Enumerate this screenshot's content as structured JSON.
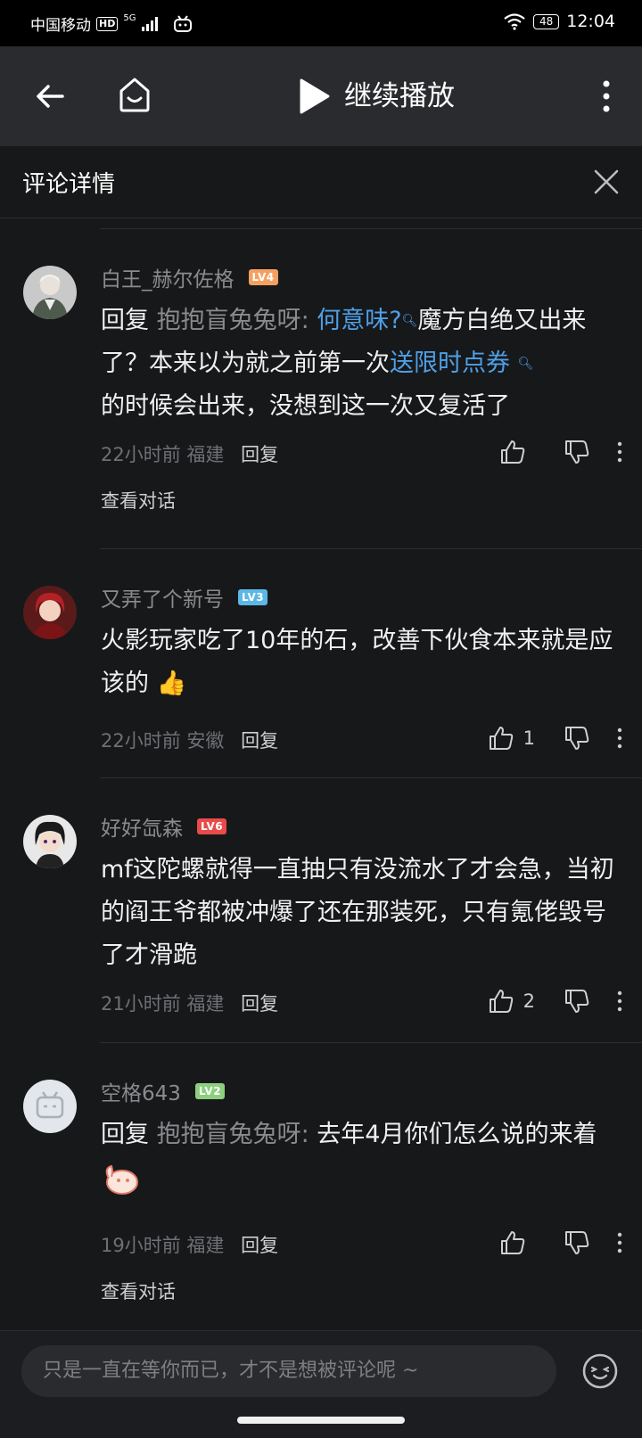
{
  "status_bar": {
    "carrier": "中国移动",
    "hd": "HD",
    "network": "5G",
    "battery": "48",
    "time": "12:04"
  },
  "nav": {
    "title": "继续播放"
  },
  "header": {
    "title": "评论详情"
  },
  "colors": {
    "background": "#17181a",
    "link": "#4fa0e6",
    "lv4": "#f5a062",
    "lv3": "#5bb8e6",
    "lv6": "#e84b4b",
    "lv2": "#8ccf7e"
  },
  "comments": [
    {
      "username": "白王_赫尔佐格",
      "level": "LV4",
      "content": {
        "reply_prefix": "回复 ",
        "reply_to": "抱抱盲兔兔呀:",
        "link1": "何意味?",
        "text1": "魔方白绝又出来了？本来以为就之前第一次",
        "link2": "送限时点券",
        "text2": "的时候会出来，没想到这一次又复活了"
      },
      "time": "22小时前",
      "location": "福建",
      "reply_label": "回复",
      "likes": "",
      "view_conversation": "查看对话"
    },
    {
      "username": "又弄了个新号",
      "level": "LV3",
      "content": {
        "text": "火影玩家吃了10年的石，改善下伙食本来就是应该的",
        "emoji": "👍"
      },
      "time": "22小时前",
      "location": "安徽",
      "reply_label": "回复",
      "likes": "1"
    },
    {
      "username": "好好氙森",
      "level": "LV6",
      "content": {
        "text": "mf这陀螺就得一直抽只有没流水了才会急，当初的阎王爷都被冲爆了还在那装死，只有氪佬毁号了才滑跪"
      },
      "time": "21小时前",
      "location": "福建",
      "reply_label": "回复",
      "likes": "2"
    },
    {
      "username": "空格643",
      "level": "LV2",
      "content": {
        "reply_prefix": "回复 ",
        "reply_to": "抱抱盲兔兔呀:",
        "text": " 去年4月你们怎么说的来着"
      },
      "time": "19小时前",
      "location": "福建",
      "reply_label": "回复",
      "likes": "",
      "view_conversation": "查看对话"
    }
  ],
  "input": {
    "placeholder": "只是一直在等你而已，才不是想被评论呢 ~"
  }
}
